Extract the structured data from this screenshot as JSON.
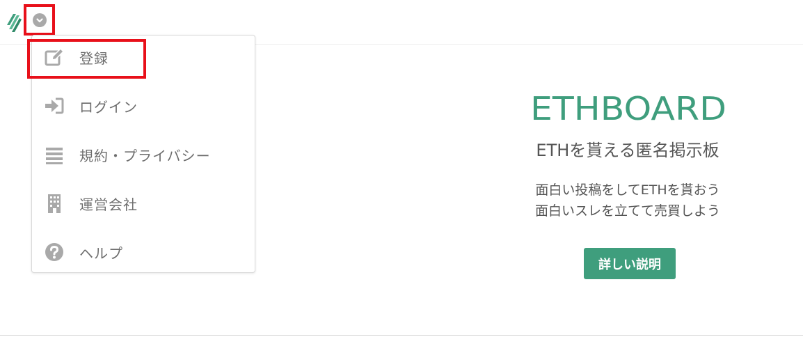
{
  "header": {
    "logo_icon": "ethboard-leaf-logo-icon",
    "dropdown_icon": "chevron-down-circle-icon"
  },
  "menu": {
    "items": [
      {
        "label": "登録",
        "icon": "edit-icon"
      },
      {
        "label": "ログイン",
        "icon": "sign-in-icon"
      },
      {
        "label": "規約・プライバシー",
        "icon": "list-icon"
      },
      {
        "label": "運営会社",
        "icon": "building-icon"
      },
      {
        "label": "ヘルプ",
        "icon": "question-circle-icon"
      }
    ]
  },
  "hero": {
    "brand": "ETHBOARD",
    "tagline": "ETHを貰える匿名掲示板",
    "desc_line1": "面白い投稿をしてETHを貰おう",
    "desc_line2": "面白いスレを立てて売買しよう",
    "detail_button": "詳しい説明"
  },
  "colors": {
    "brand_green": "#3f9e7d",
    "highlight_red": "#e8101a",
    "icon_gray": "#a9a9a9"
  }
}
